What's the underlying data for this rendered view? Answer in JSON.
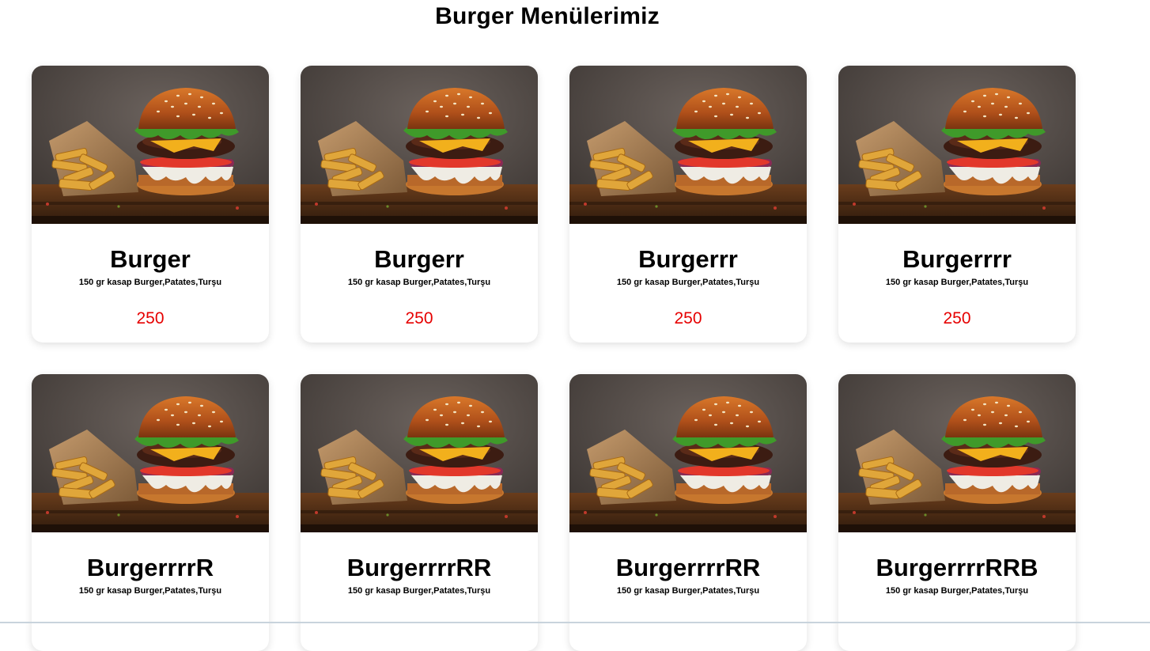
{
  "page": {
    "title": "Burger Menülerimiz"
  },
  "colors": {
    "price": "#e60000",
    "card_background": "#ffffff"
  },
  "menu": {
    "items": [
      {
        "name": "Burger",
        "description": "150 gr kasap Burger,Patates,Turşu",
        "price": "250",
        "image": "burger-photo"
      },
      {
        "name": "Burgerr",
        "description": "150 gr kasap Burger,Patates,Turşu",
        "price": "250",
        "image": "burger-photo"
      },
      {
        "name": "Burgerrr",
        "description": "150 gr kasap Burger,Patates,Turşu",
        "price": "250",
        "image": "burger-photo"
      },
      {
        "name": "Burgerrrr",
        "description": "150 gr kasap Burger,Patates,Turşu",
        "price": "250",
        "image": "burger-photo"
      },
      {
        "name": "BurgerrrrR",
        "description": "150 gr kasap Burger,Patates,Turşu",
        "price": "",
        "image": "burger-photo"
      },
      {
        "name": "BurgerrrrRR",
        "description": "150 gr kasap Burger,Patates,Turşu",
        "price": "",
        "image": "burger-photo"
      },
      {
        "name": "BurgerrrrRR",
        "description": "150 gr kasap Burger,Patates,Turşu",
        "price": "",
        "image": "burger-photo"
      },
      {
        "name": "BurgerrrrRRB",
        "description": "150 gr kasap Burger,Patates,Turşu",
        "price": "",
        "image": "burger-photo"
      }
    ]
  }
}
